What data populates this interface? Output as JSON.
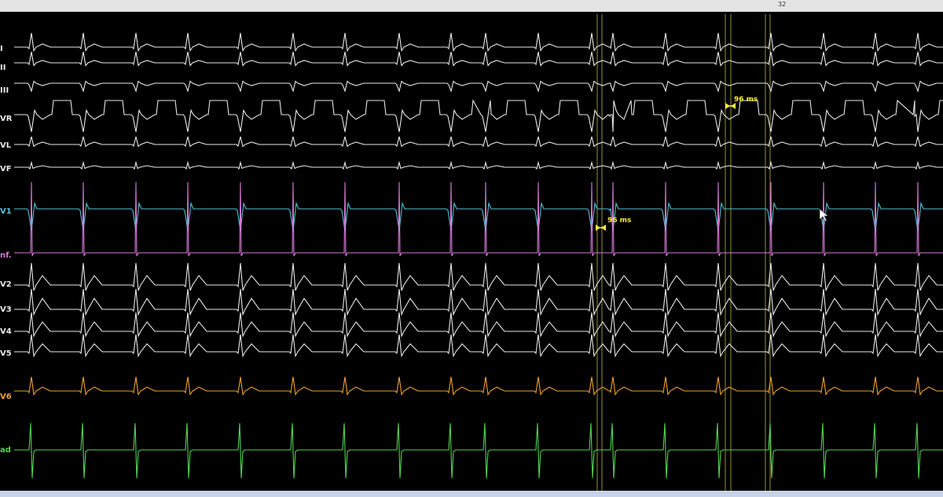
{
  "header": {
    "sweep_speed": "32"
  },
  "leads": [
    {
      "id": "I",
      "label": "I",
      "color": "#e8e8e8"
    },
    {
      "id": "II",
      "label": "II",
      "color": "#e8e8e8"
    },
    {
      "id": "III",
      "label": "III",
      "color": "#e8e8e8"
    },
    {
      "id": "aVR",
      "label": "VR",
      "color": "#e8e8e8"
    },
    {
      "id": "aVL",
      "label": "VL",
      "color": "#e8e8e8"
    },
    {
      "id": "aVF",
      "label": "VF",
      "color": "#e8e8e8"
    },
    {
      "id": "V1",
      "label": "V1",
      "color": "#4fc3d9"
    },
    {
      "id": "Inf",
      "label": "nf.",
      "color": "#d67ad6"
    },
    {
      "id": "V2",
      "label": "V2",
      "color": "#e8e8e8"
    },
    {
      "id": "V3",
      "label": "V3",
      "color": "#e8e8e8"
    },
    {
      "id": "V4",
      "label": "V4",
      "color": "#e8e8e8"
    },
    {
      "id": "V5",
      "label": "V5",
      "color": "#e8e8e8"
    },
    {
      "id": "V6",
      "label": "V6",
      "color": "#f0a030"
    },
    {
      "id": "Rad",
      "label": "ad",
      "color": "#55d655"
    }
  ],
  "measurements": [
    {
      "name": "caliper-upper",
      "value": "96 ms"
    },
    {
      "name": "caliper-lower",
      "value": "96 ms"
    }
  ],
  "colors": {
    "caliper": "#ffee33",
    "marker": "#b8b840",
    "background": "#000000"
  }
}
